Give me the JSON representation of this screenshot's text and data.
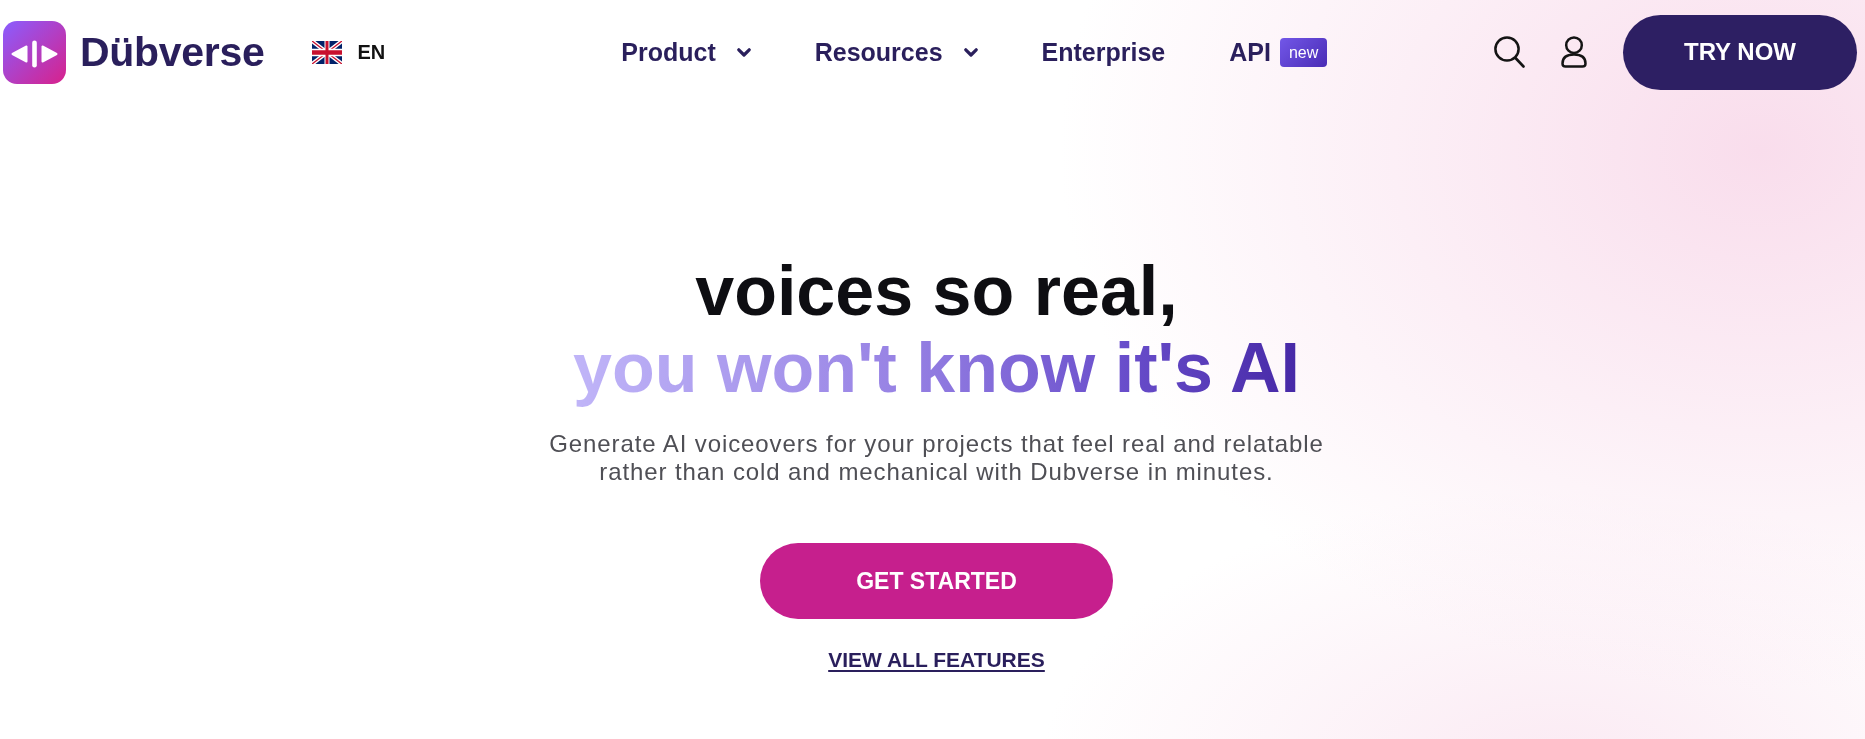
{
  "header": {
    "logo": {
      "wordmark": "Dübverse"
    },
    "language": {
      "code": "EN"
    },
    "nav": [
      {
        "label": "Product",
        "kind": "dropdown"
      },
      {
        "label": "Resources",
        "kind": "dropdown"
      },
      {
        "label": "Enterprise",
        "kind": "link"
      },
      {
        "label": "API",
        "kind": "link",
        "badge": "new"
      }
    ],
    "cta": "TRY NOW"
  },
  "hero": {
    "title_line_1": "voices so real,",
    "title_line_2": "you won't know it's AI",
    "subtitle": "Generate AI voiceovers for your projects that feel real and relatable rather than cold and mechanical with Dubverse in minutes.",
    "primary_button": "GET STARTED",
    "secondary_link": "VIEW ALL FEATURES"
  }
}
